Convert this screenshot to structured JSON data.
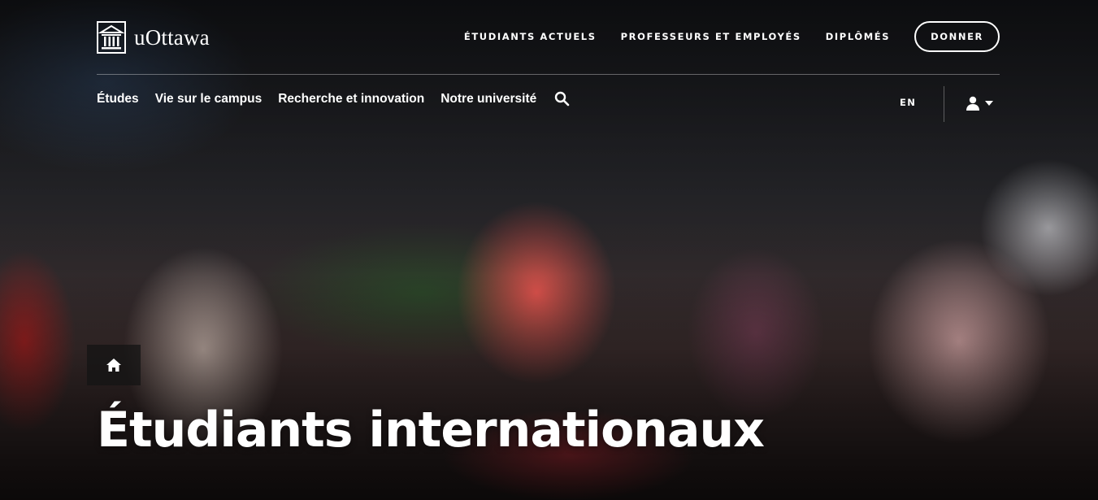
{
  "brand": {
    "name": "uOttawa"
  },
  "utility_nav": [
    {
      "label": "ÉTUDIANTS ACTUELS"
    },
    {
      "label": "PROFESSEURS ET EMPLOYÉS"
    },
    {
      "label": "DIPLÔMÉS"
    }
  ],
  "donate_label": "DONNER",
  "main_nav": [
    {
      "label": "Études"
    },
    {
      "label": "Vie sur le campus"
    },
    {
      "label": "Recherche et innovation"
    },
    {
      "label": "Notre université"
    }
  ],
  "language_toggle": "EN",
  "page_title": "Étudiants internationaux",
  "icons": {
    "logo": "university-building-icon",
    "search": "search-icon",
    "user": "user-icon",
    "dropdown": "caret-down-icon",
    "home": "home-icon"
  }
}
